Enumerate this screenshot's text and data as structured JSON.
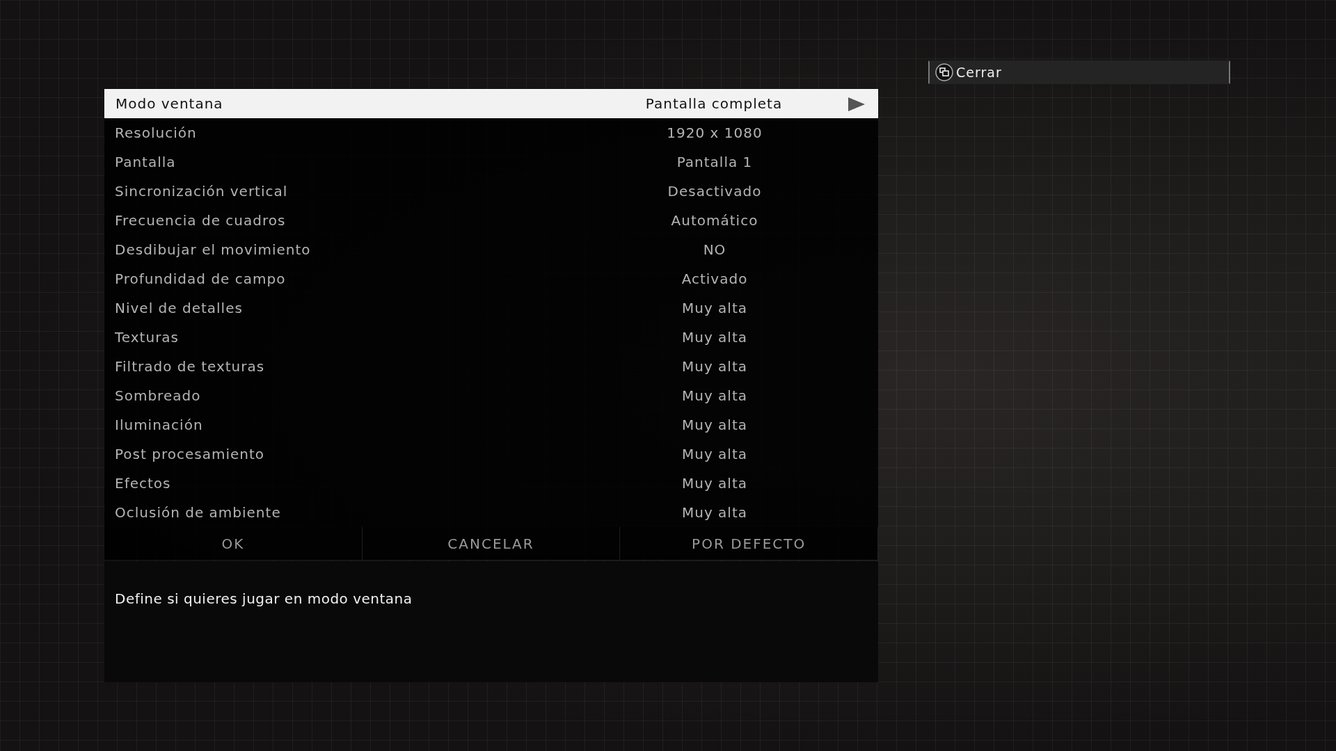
{
  "close_button": {
    "label": "Cerrar"
  },
  "settings": [
    {
      "label": "Modo ventana",
      "value": "Pantalla completa",
      "selected": true
    },
    {
      "label": "Resolución",
      "value": "1920 x 1080",
      "selected": false
    },
    {
      "label": "Pantalla",
      "value": "Pantalla 1",
      "selected": false
    },
    {
      "label": "Sincronización vertical",
      "value": "Desactivado",
      "selected": false
    },
    {
      "label": "Frecuencia de cuadros",
      "value": "Automático",
      "selected": false
    },
    {
      "label": "Desdibujar el movimiento",
      "value": "NO",
      "selected": false
    },
    {
      "label": "Profundidad de campo",
      "value": "Activado",
      "selected": false
    },
    {
      "label": "Nivel de detalles",
      "value": "Muy alta",
      "selected": false
    },
    {
      "label": "Texturas",
      "value": "Muy alta",
      "selected": false
    },
    {
      "label": "Filtrado de texturas",
      "value": "Muy alta",
      "selected": false
    },
    {
      "label": "Sombreado",
      "value": "Muy alta",
      "selected": false
    },
    {
      "label": "Iluminación",
      "value": "Muy alta",
      "selected": false
    },
    {
      "label": "Post procesamiento",
      "value": "Muy alta",
      "selected": false
    },
    {
      "label": "Efectos",
      "value": "Muy alta",
      "selected": false
    },
    {
      "label": "Oclusión de ambiente",
      "value": "Muy alta",
      "selected": false
    }
  ],
  "buttons": [
    "OK",
    "CANCELAR",
    "POR DEFECTO"
  ],
  "description": "Define si quieres jugar en modo ventana"
}
